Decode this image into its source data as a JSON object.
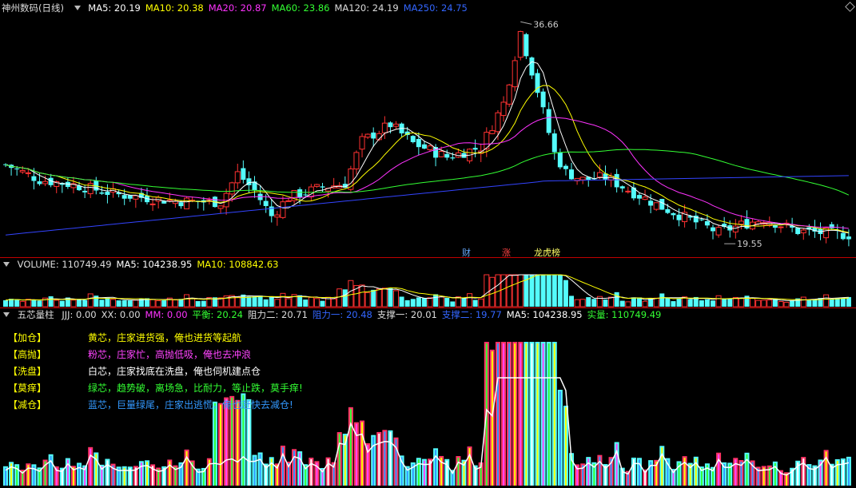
{
  "price_panel": {
    "title": "神州数码(日线)",
    "ma_labels": [
      {
        "text": "MA5: 20.19",
        "color": "#ffffff"
      },
      {
        "text": "MA10: 20.38",
        "color": "#ffff00"
      },
      {
        "text": "MA20: 20.87",
        "color": "#ff33ff"
      },
      {
        "text": "MA60: 23.86",
        "color": "#33ff33"
      },
      {
        "text": "MA120: 24.19",
        "color": "#dddddd"
      },
      {
        "text": "MA250: 24.75",
        "color": "#3366ff"
      }
    ],
    "high_label": "36.66",
    "low_label": "19.55",
    "markers": [
      {
        "text": "财",
        "color": "#66aaff"
      },
      {
        "text": "涨",
        "color": "#ff4444"
      },
      {
        "text": "龙虎榜",
        "color": "#ffff66"
      }
    ]
  },
  "volume_panel": {
    "labels": [
      {
        "text": "VOLUME: 110749.49",
        "color": "#dddddd"
      },
      {
        "text": "MA5: 104238.95",
        "color": "#ffffff"
      },
      {
        "text": "MA10: 108842.63",
        "color": "#ffff00"
      }
    ]
  },
  "indicator_panel": {
    "title": "五芯量柱",
    "labels": [
      {
        "text": "JJJ: 0.00",
        "color": "#dddddd"
      },
      {
        "text": "XX: 0.00",
        "color": "#dddddd"
      },
      {
        "text": "MM: 0.00",
        "color": "#ff33ff"
      },
      {
        "text": "平衡: 20.24",
        "color": "#33ff33"
      },
      {
        "text": "阻力二: 20.71",
        "color": "#dddddd"
      },
      {
        "text": "阻力一: 20.48",
        "color": "#3366ff"
      },
      {
        "text": "支撑一: 20.01",
        "color": "#dddddd"
      },
      {
        "text": "支撑二: 19.77",
        "color": "#3366ff"
      },
      {
        "text": "MA5: 104238.95",
        "color": "#ffffff"
      },
      {
        "text": "实量: 110749.49",
        "color": "#33ff33"
      }
    ],
    "legend": [
      {
        "tag": "【加仓】",
        "desc": "黄芯，庄家进货强，俺也进货等起航",
        "color": "#ffff00"
      },
      {
        "tag": "【高抛】",
        "desc": "粉芯，庄家忙，高抛低吸，俺也去冲浪",
        "color": "#ff44ff"
      },
      {
        "tag": "【洗盘】",
        "desc": "白芯，庄家找底在洗盘，俺也伺机建点仓",
        "color": "#ffffff"
      },
      {
        "tag": "【莫痒】",
        "desc": "绿芯，趋势破，离场急，比耐力，等止跌，莫手痒!",
        "color": "#33ff33"
      },
      {
        "tag": "【减仓】",
        "desc": "蓝芯，巨量绿尾，庄家出逃慌，俺也赶快去减仓!",
        "color": "#3399ff"
      }
    ]
  },
  "colors": {
    "up": "#ff3232",
    "down": "#54fcfc",
    "ma5": "#ffffff",
    "ma10": "#ffff00",
    "ma20": "#ff33ff",
    "ma60": "#33ff33",
    "ma250": "#3344ff"
  }
}
